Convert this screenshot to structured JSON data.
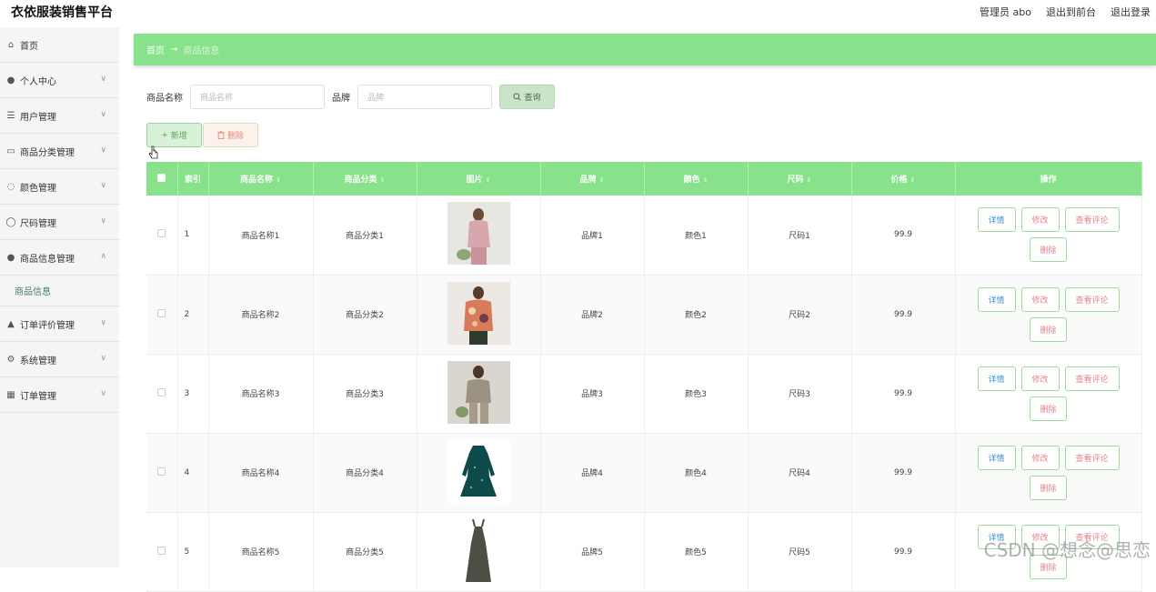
{
  "app": {
    "title": "衣依服装销售平台"
  },
  "topbar": {
    "user": "管理员 abo",
    "front": "退出到前台",
    "logout": "退出登录"
  },
  "sidebar": {
    "items": [
      {
        "label": "首页",
        "icon": "home-icon",
        "expandable": false
      },
      {
        "label": "个人中心",
        "icon": "user-icon",
        "expandable": true
      },
      {
        "label": "用户管理",
        "icon": "list-icon",
        "expandable": true
      },
      {
        "label": "商品分类管理",
        "icon": "monitor-icon",
        "expandable": true
      },
      {
        "label": "颜色管理",
        "icon": "palette-icon",
        "expandable": true
      },
      {
        "label": "尺码管理",
        "icon": "power-icon",
        "expandable": true
      },
      {
        "label": "商品信息管理",
        "icon": "user-icon",
        "expandable": true,
        "expanded": true
      },
      {
        "label": "订单评价管理",
        "icon": "thumb-icon",
        "expandable": true
      },
      {
        "label": "系统管理",
        "icon": "gear-icon",
        "expandable": true
      },
      {
        "label": "订单管理",
        "icon": "grid-icon",
        "expandable": true
      }
    ],
    "submenu": {
      "label": "商品信息"
    }
  },
  "breadcrumb": {
    "home": "首页",
    "arrow": "→",
    "current": "商品信息"
  },
  "search": {
    "name_label": "商品名称",
    "name_placeholder": "商品名称",
    "brand_label": "品牌",
    "brand_placeholder": "品牌",
    "button": "查询"
  },
  "actions": {
    "add": "新增",
    "delete": "删除"
  },
  "table": {
    "headers": [
      "索引",
      "商品名称",
      "商品分类",
      "图片",
      "品牌",
      "颜色",
      "尺码",
      "价格",
      "操作"
    ],
    "rows": [
      {
        "index": "1",
        "name": "商品名称1",
        "category": "商品分类1",
        "brand": "品牌1",
        "color": "颜色1",
        "size": "尺码1",
        "price": "99.9"
      },
      {
        "index": "2",
        "name": "商品名称2",
        "category": "商品分类2",
        "brand": "品牌2",
        "color": "颜色2",
        "size": "尺码2",
        "price": "99.9"
      },
      {
        "index": "3",
        "name": "商品名称3",
        "category": "商品分类3",
        "brand": "品牌3",
        "color": "颜色3",
        "size": "尺码3",
        "price": "99.9"
      },
      {
        "index": "4",
        "name": "商品名称4",
        "category": "商品分类4",
        "brand": "品牌4",
        "color": "颜色4",
        "size": "尺码4",
        "price": "99.9"
      },
      {
        "index": "5",
        "name": "商品名称5",
        "category": "商品分类5",
        "brand": "品牌5",
        "color": "颜色5",
        "size": "尺码5",
        "price": "99.9"
      }
    ],
    "ops": {
      "detail": "详情",
      "edit": "修改",
      "comment": "查看评论",
      "delete": "删除"
    }
  },
  "watermark": "CSDN @想念@思恋",
  "colors": {
    "accent": "#88e28b",
    "sidebar_bg": "#f5f5f5"
  }
}
